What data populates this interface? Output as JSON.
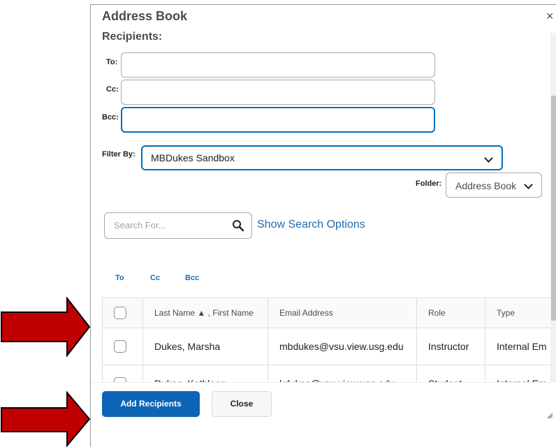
{
  "dialog": {
    "title": "Address Book",
    "close_glyph": "×",
    "recipients_label": "Recipients:",
    "to_label": "To:",
    "cc_label": "Cc:",
    "bcc_label": "Bcc:",
    "to_value": "",
    "cc_value": "",
    "bcc_value": ""
  },
  "filter": {
    "label": "Filter By:",
    "selected": "MBDukes Sandbox",
    "folder_label": "Folder:",
    "folder_selected": "Address Book"
  },
  "search": {
    "placeholder": "Search For...",
    "options_link": "Show Search Options",
    "icon": "search-icon"
  },
  "add_links": [
    "To",
    "Cc",
    "Bcc"
  ],
  "table": {
    "headers": [
      "",
      "Last Name ▲ , First Name",
      "Email Address",
      "Role",
      "Type"
    ],
    "rows": [
      {
        "name": "Dukes, Marsha",
        "email": "mbdukes@vsu.view.usg.edu",
        "role": "Instructor",
        "type": "Internal Em"
      },
      {
        "name": "Dukes, Kathleen",
        "email": "kdukes@vsu.view.usg.edu",
        "role": "Student",
        "type": "Internal Em"
      }
    ]
  },
  "footer": {
    "add_button": "Add Recipients",
    "close_button": "Close"
  },
  "colors": {
    "primary": "#0d65b6",
    "link": "#1c6bb0",
    "focus": "#006fbf",
    "arrow": "#c00000"
  }
}
